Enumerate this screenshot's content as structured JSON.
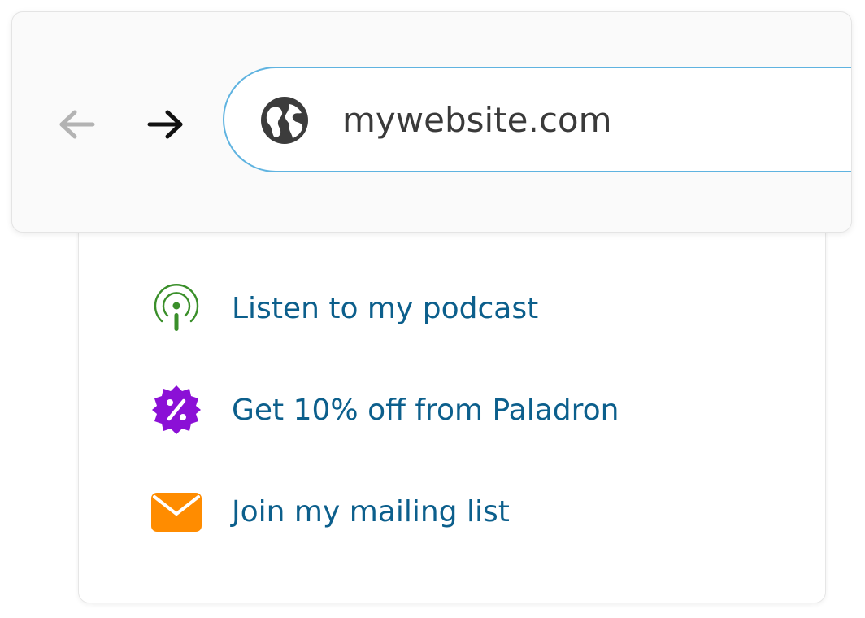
{
  "browser": {
    "url": "mywebsite.com",
    "back_icon": "arrow-left-icon",
    "forward_icon": "arrow-right-icon",
    "site_icon": "globe-icon",
    "back_enabled": false,
    "forward_enabled": true,
    "accent_color": "#5fb3e0"
  },
  "links": {
    "items": [
      {
        "label": "Listen to my podcast",
        "icon": "podcast-icon",
        "icon_color": "#3a8f2a"
      },
      {
        "label": "Get 10% off from Paladron",
        "icon": "discount-badge-icon",
        "icon_color": "#8b10d6"
      },
      {
        "label": "Join my mailing list",
        "icon": "envelope-icon",
        "icon_color": "#ff8c00"
      }
    ],
    "text_color": "#0c5f8c"
  }
}
